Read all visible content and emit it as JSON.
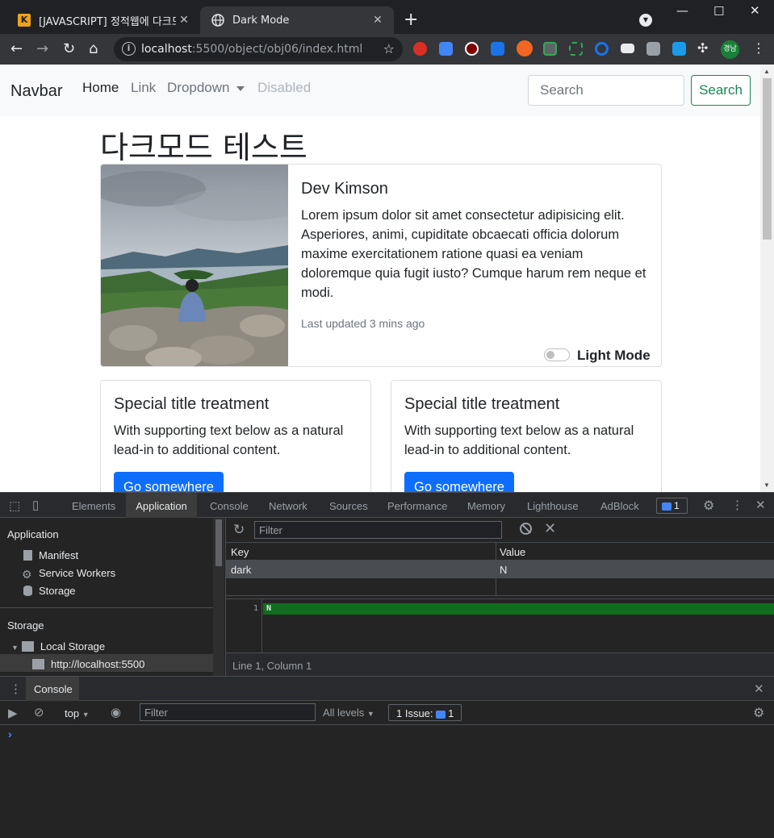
{
  "browser": {
    "tabs": [
      {
        "title": "[JAVASCRIPT] 정적웹에 다크모드",
        "favicon": "K"
      },
      {
        "title": "Dark Mode"
      }
    ],
    "new_tab": "+",
    "profile_badge": "경남",
    "url_host": "localhost",
    "url_rest": ":5500/object/obj06/index.html"
  },
  "page": {
    "navbar": {
      "brand": "Navbar",
      "links": [
        "Home",
        "Link",
        "Dropdown",
        "Disabled"
      ],
      "search_placeholder": "Search",
      "search_button": "Search"
    },
    "heading": "다크모드 테스트",
    "profile_card": {
      "name": "Dev Kimson",
      "text": "Lorem ipsum dolor sit amet consectetur adipisicing elit. Asperiores, animi, cupiditate obcaecati officia dolorum maxime exercitationem ratione quasi ea veniam doloremque quia fugit iusto? Cumque harum rem neque et modi.",
      "updated": "Last updated 3 mins ago",
      "mode_label": "Light Mode",
      "dark_mode_on": false
    },
    "cards": [
      {
        "title": "Special title treatment",
        "text": "With supporting text below as a natural lead-in to additional content.",
        "button": "Go somewhere"
      },
      {
        "title": "Special title treatment",
        "text": "With supporting text below as a natural lead-in to additional content.",
        "button": "Go somewhere"
      }
    ],
    "colors": {
      "primary": "#0d6efd",
      "success": "#198754"
    }
  },
  "devtools": {
    "tabs": [
      "Elements",
      "Application",
      "Console",
      "Network",
      "Sources",
      "Performance",
      "Memory",
      "Lighthouse",
      "AdBlock"
    ],
    "active_tab": "Application",
    "issues_count": "1",
    "sidebar": {
      "application_header": "Application",
      "application_items": [
        "Manifest",
        "Service Workers",
        "Storage"
      ],
      "storage_header": "Storage",
      "local_storage": "Local Storage",
      "origin": "http://localhost:5500"
    },
    "storage": {
      "filter_placeholder": "Filter",
      "columns": [
        "Key",
        "Value"
      ],
      "rows": [
        {
          "key": "dark",
          "value": "N"
        }
      ],
      "preview_line": "1",
      "preview_value": "N",
      "cursor": "Line 1, Column 1"
    },
    "drawer": {
      "tab": "Console",
      "context": "top",
      "filter_placeholder": "Filter",
      "levels": "All levels",
      "issues_label": "1 Issue:",
      "issues_count": "1",
      "prompt": "›"
    }
  }
}
